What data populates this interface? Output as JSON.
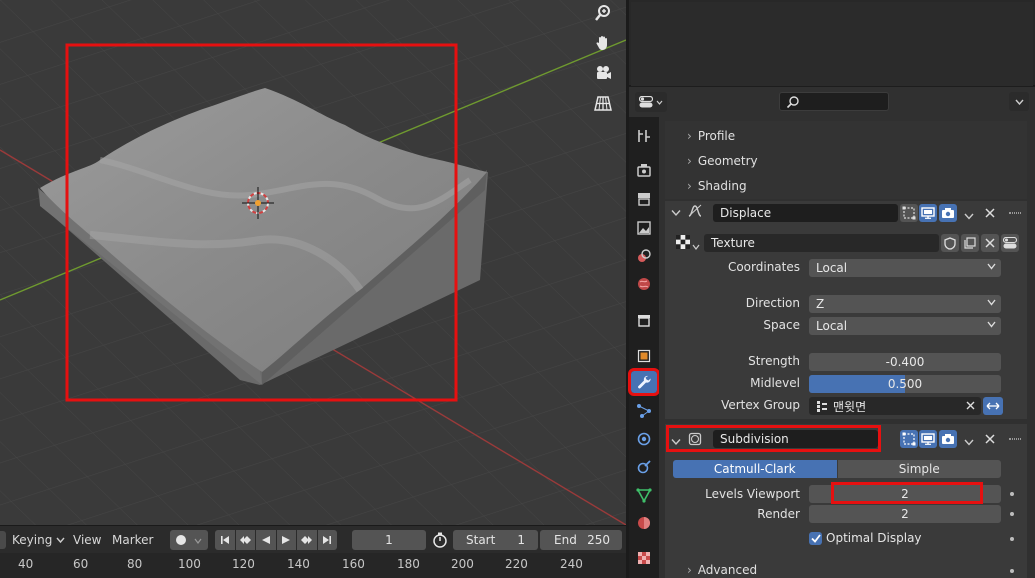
{
  "timeline": {
    "menu": [
      "Keying",
      "View",
      "Marker"
    ],
    "current_frame": "1",
    "start_label": "Start",
    "start_value": "1",
    "end_label": "End",
    "end_value": "250",
    "ruler_ticks": [
      "40",
      "60",
      "80",
      "100",
      "120",
      "140",
      "160",
      "180",
      "200",
      "220",
      "240"
    ]
  },
  "properties": {
    "search_placeholder": "",
    "sections": [
      "Profile",
      "Geometry",
      "Shading"
    ],
    "displace": {
      "name": "Displace",
      "texture": "Texture",
      "coordinates_label": "Coordinates",
      "coordinates_value": "Local",
      "direction_label": "Direction",
      "direction_value": "Z",
      "space_label": "Space",
      "space_value": "Local",
      "strength_label": "Strength",
      "strength_value": "-0.400",
      "midlevel_label": "Midlevel",
      "midlevel_value": "0.500",
      "midlevel_fraction": 0.5,
      "vertex_group_label": "Vertex Group",
      "vertex_group_value": "맨윗면"
    },
    "subdivision": {
      "name": "Subdivision",
      "catmull_label": "Catmull-Clark",
      "simple_label": "Simple",
      "levels_viewport_label": "Levels Viewport",
      "levels_viewport_value": "2",
      "render_label": "Render",
      "render_value": "2",
      "optimal_display_label": "Optimal Display",
      "advanced_label": "Advanced"
    }
  },
  "colors": {
    "highlight": "#e61010",
    "accent": "#4772b3",
    "active_tab": "#4772b3"
  }
}
